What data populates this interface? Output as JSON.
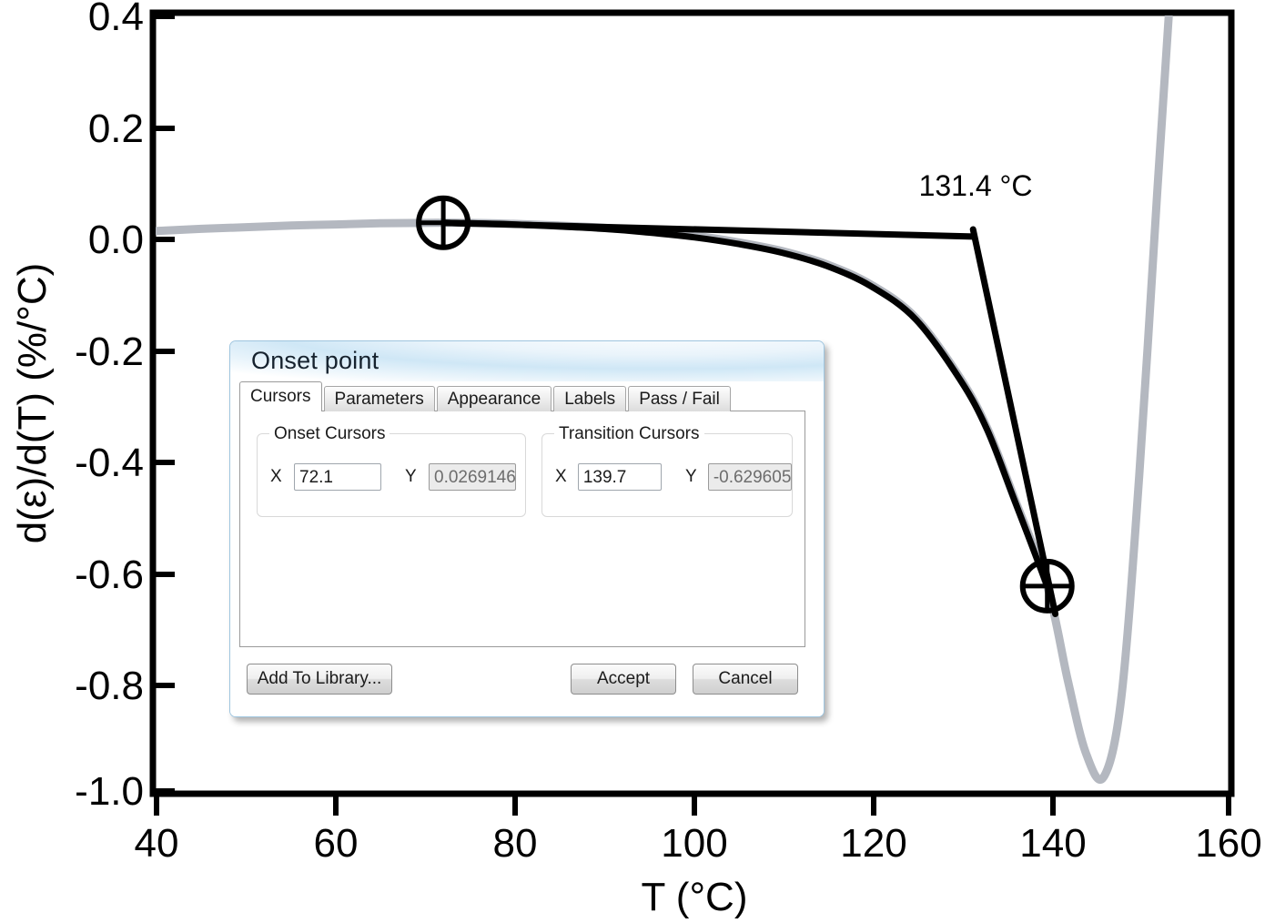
{
  "chart_data": {
    "type": "line",
    "title": "",
    "xlabel": "T (°C)",
    "ylabel": "d(ε)/d(T) (%/°C)",
    "xlim": [
      40,
      160
    ],
    "ylim": [
      -1.0,
      0.4
    ],
    "xticks": [
      "40",
      "60",
      "80",
      "100",
      "120",
      "140",
      "160"
    ],
    "yticks": [
      "0.4",
      "0.2",
      "0.0",
      "-0.2",
      "-0.4",
      "-0.6",
      "-0.8",
      "-1.0"
    ],
    "grid": false,
    "legend": "none",
    "annotations": [
      {
        "text": "131.4 °C",
        "x": 131.4,
        "y": 0.12
      }
    ],
    "series": [
      {
        "name": "d(ε)/d(T)",
        "color": "#b4b8c0",
        "points": [
          [
            40.0,
            0.012
          ],
          [
            45.0,
            0.016
          ],
          [
            50.0,
            0.019
          ],
          [
            55.0,
            0.022
          ],
          [
            60.0,
            0.024
          ],
          [
            65.0,
            0.026
          ],
          [
            70.0,
            0.0268
          ],
          [
            72.1,
            0.0269
          ],
          [
            75.0,
            0.0268
          ],
          [
            80.0,
            0.025
          ],
          [
            85.0,
            0.022
          ],
          [
            90.0,
            0.018
          ],
          [
            95.0,
            0.012
          ],
          [
            100.0,
            0.004
          ],
          [
            105.0,
            -0.008
          ],
          [
            110.0,
            -0.024
          ],
          [
            115.0,
            -0.048
          ],
          [
            120.0,
            -0.085
          ],
          [
            125.0,
            -0.145
          ],
          [
            130.0,
            -0.255
          ],
          [
            133.0,
            -0.345
          ],
          [
            136.0,
            -0.47
          ],
          [
            139.7,
            -0.6296
          ],
          [
            142.0,
            -0.8
          ],
          [
            144.0,
            -0.93
          ],
          [
            146.0,
            -0.975
          ],
          [
            148.0,
            -0.83
          ],
          [
            150.0,
            -0.43
          ],
          [
            152.0,
            0.08
          ],
          [
            153.3,
            0.4
          ]
        ]
      },
      {
        "name": "onset-baseline-tangent",
        "color": "#000000",
        "points": [
          [
            72.1,
            0.0269
          ],
          [
            131.4,
            0.002
          ]
        ]
      },
      {
        "name": "onset-transition-tangent",
        "color": "#000000",
        "points": [
          [
            131.4,
            0.015
          ],
          [
            140.6,
            -0.68
          ]
        ]
      },
      {
        "name": "fit-overlay",
        "color": "#000000",
        "points": [
          [
            72.1,
            0.0269
          ],
          [
            80.0,
            0.024
          ],
          [
            90.0,
            0.016
          ],
          [
            95.0,
            0.0095
          ],
          [
            100.0,
            0.001
          ],
          [
            105.0,
            -0.011
          ],
          [
            110.0,
            -0.027
          ],
          [
            115.0,
            -0.051
          ],
          [
            120.0,
            -0.088
          ],
          [
            125.0,
            -0.148
          ],
          [
            130.0,
            -0.258
          ],
          [
            133.0,
            -0.348
          ],
          [
            136.0,
            -0.473
          ],
          [
            139.7,
            -0.6296
          ]
        ]
      }
    ],
    "cursors": [
      {
        "name": "onset-cursor",
        "x": 72.1,
        "y": 0.026914
      },
      {
        "name": "transition-cursor",
        "x": 139.7,
        "y": -0.629605
      }
    ]
  },
  "dialog": {
    "title": "Onset point",
    "tabs": [
      {
        "label": "Cursors",
        "active": true
      },
      {
        "label": "Parameters",
        "active": false
      },
      {
        "label": "Appearance",
        "active": false
      },
      {
        "label": "Labels",
        "active": false
      },
      {
        "label": "Pass / Fail",
        "active": false
      }
    ],
    "onset_group": {
      "legend": "Onset Cursors",
      "x_label": "X",
      "x_value": "72.1",
      "y_label": "Y",
      "y_value": "0.0269146"
    },
    "transition_group": {
      "legend": "Transition Cursors",
      "x_label": "X",
      "x_value": "139.7",
      "y_label": "Y",
      "y_value": "-0.629605"
    },
    "buttons": {
      "add_to_library": "Add To Library...",
      "accept": "Accept",
      "cancel": "Cancel"
    }
  },
  "colors": {
    "curve_gray": "#b4b8c0",
    "construction_black": "#000000",
    "axis_black": "#000000",
    "dialog_border": "#9fc6e0"
  }
}
